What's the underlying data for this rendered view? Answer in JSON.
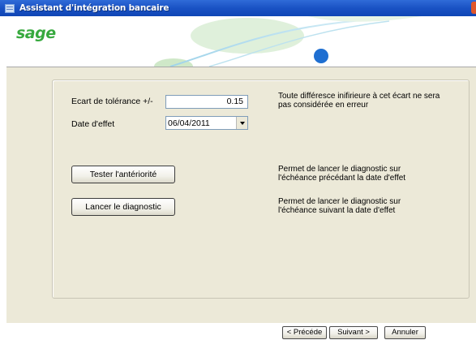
{
  "window": {
    "title": "Assistant d'intégration bancaire"
  },
  "brand": {
    "logo": "sage",
    "logo_color": "#37a93e"
  },
  "form": {
    "tolerance": {
      "label": "Ecart de tolérance +/-",
      "value": "0.15",
      "description": "Toute différesce inifirieure à cet écart ne sera pas considérée en erreur"
    },
    "date": {
      "label": "Date d'effet",
      "value": "06/04/2011"
    }
  },
  "actions": {
    "test_button": "Tester l'antériorité",
    "test_description": "Permet de lancer le diagnostic sur l'échéance précédant la date d'effet",
    "run_button": "Lancer le diagnostic",
    "run_description": "Permet de lancer le diagnostic sur l'échéance suivant la date d'effet"
  },
  "navigation": {
    "previous": "< Précéde",
    "next": "Suivant >",
    "cancel": "Annuler"
  },
  "colors": {
    "titlebar": "#1a52c4",
    "panel": "#ece9d8",
    "accent_blue": "#1f6fd1",
    "accent_green": "#4fb84f"
  }
}
